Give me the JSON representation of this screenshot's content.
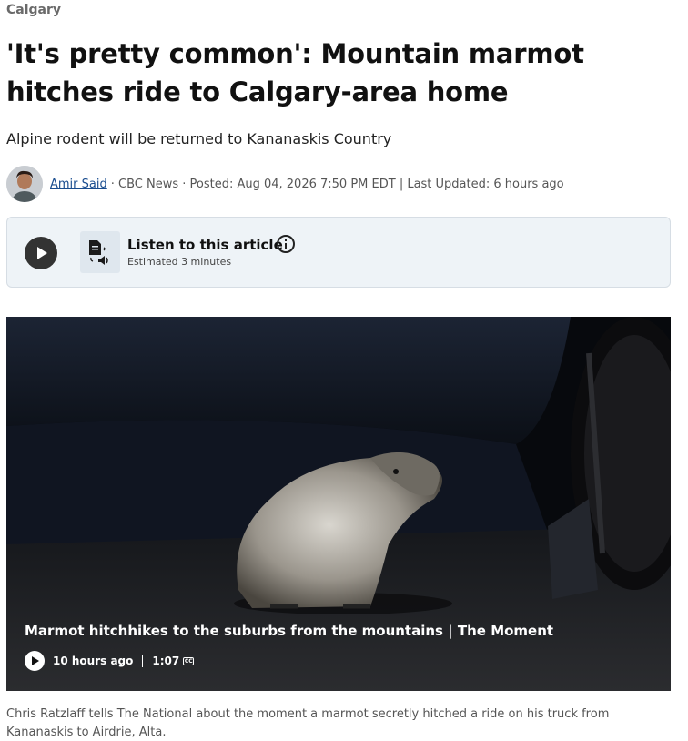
{
  "section": "Calgary",
  "headline": "'It's pretty common': Mountain marmot hitches ride to Calgary-area home",
  "deck": "Alpine rodent will be returned to Kananaskis Country",
  "byline": {
    "author": "Amir Said",
    "meta": "· CBC News · Posted: Aug 04, 2026 7:50 PM EDT | Last Updated: 6 hours ago"
  },
  "listen": {
    "title": "Listen to this article",
    "estimate": "Estimated 3 minutes"
  },
  "video": {
    "title": "Marmot hitchhikes to the suburbs from the mountains | The Moment",
    "age": "10 hours ago",
    "duration": "1:07",
    "cc_label": "CC"
  },
  "caption": "Chris Ratzlaff tells The National about the moment a marmot secretly hitched a ride on his truck from Kananaskis to Airdrie, Alta."
}
